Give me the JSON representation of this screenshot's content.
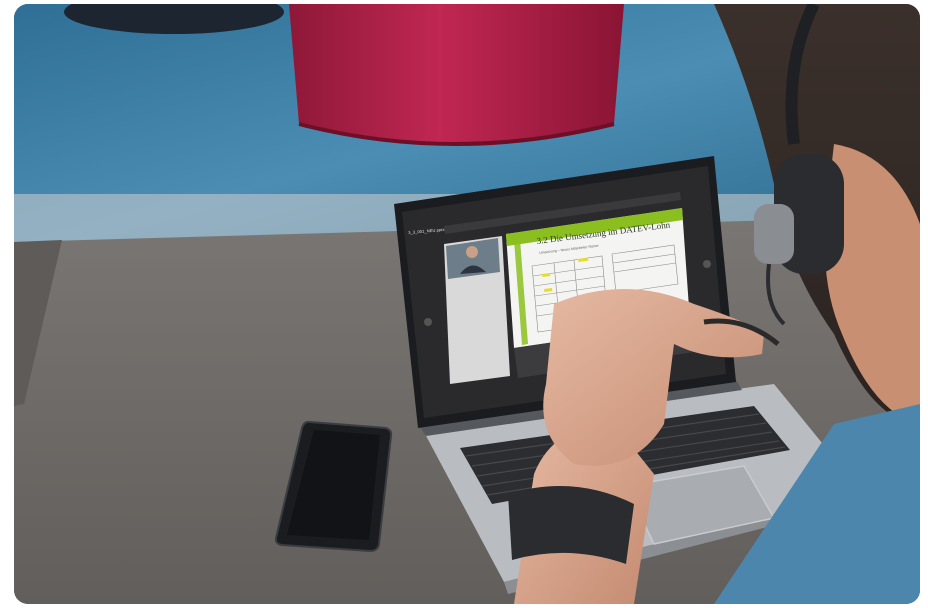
{
  "laptop_screen": {
    "file_title": "3_3_001_NEU.pptx",
    "slide_heading": "3.2 Die Umsetzung im DATEV-Lohn",
    "slide_subheading": "Umsetzung – Neuer Mitarbeiter Rainer"
  },
  "colors": {
    "rug_blue": "#3f7fa6",
    "pouf_magenta": "#b8204a",
    "desk_gray": "#6f6b68",
    "slide_green": "#8bbf1f"
  }
}
